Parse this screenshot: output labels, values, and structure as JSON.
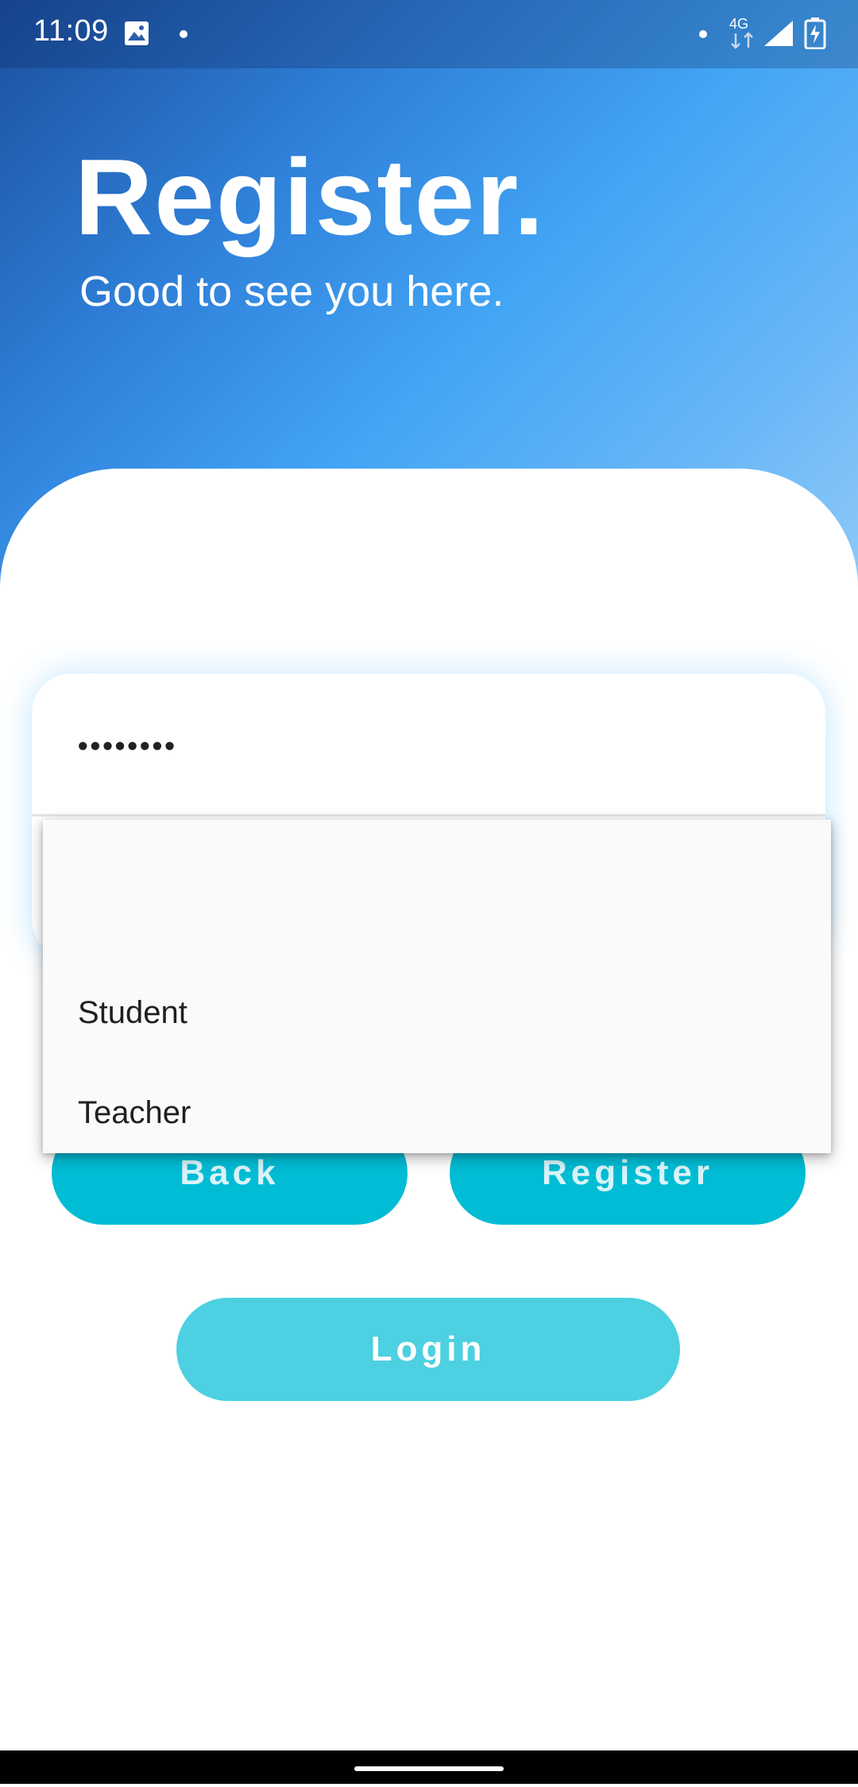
{
  "status_bar": {
    "time": "11:09",
    "network": "4G",
    "icons": [
      "image-icon",
      "notification-dot-icon",
      "signal-icon",
      "battery-charging-icon"
    ]
  },
  "header": {
    "title": "Register.",
    "subtitle": "Good to see you here."
  },
  "form": {
    "password_value": "••••••••"
  },
  "dropdown": {
    "options": [
      "",
      "Student",
      "Teacher"
    ]
  },
  "buttons": {
    "back_label": "Back",
    "register_label": "Register",
    "login_label": "Login"
  },
  "colors": {
    "header_gradient_start": "#1a4f9e",
    "header_gradient_end": "#90caf9",
    "primary_button": "#00bcd4",
    "secondary_button": "#4dd0e1",
    "dropdown_bg": "#fafafa"
  }
}
